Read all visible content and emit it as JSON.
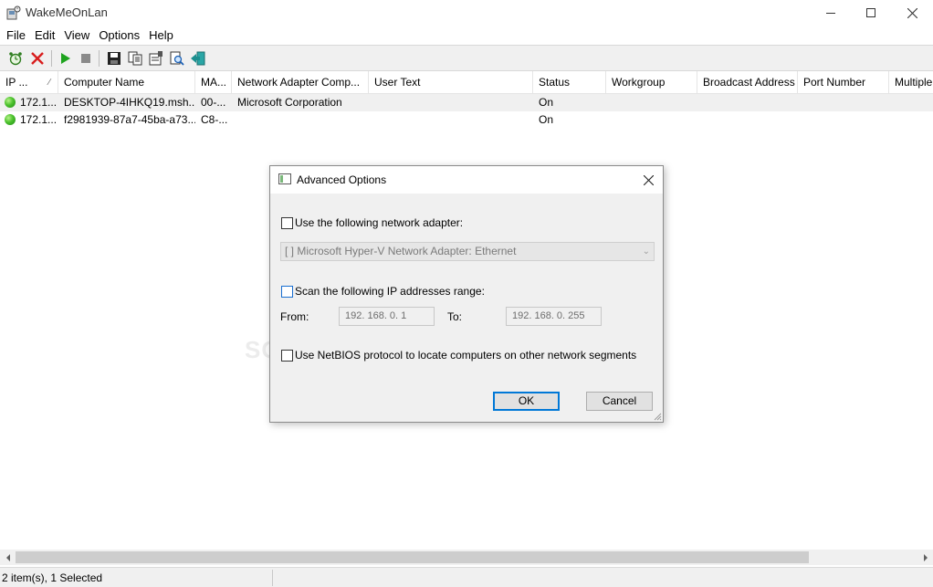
{
  "window": {
    "title": "WakeMeOnLan"
  },
  "menu": [
    "File",
    "Edit",
    "View",
    "Options",
    "Help"
  ],
  "toolbar_icons": [
    "alarm-clock-icon",
    "delete-x-icon",
    "play-icon",
    "stop-icon",
    "save-icon",
    "copy-icon",
    "properties-icon",
    "find-icon",
    "exit-icon"
  ],
  "columns": [
    {
      "label": "IP ...",
      "sort": "ascending"
    },
    {
      "label": "Computer Name"
    },
    {
      "label": "MA..."
    },
    {
      "label": "Network Adapter Comp..."
    },
    {
      "label": "User Text"
    },
    {
      "label": "Status"
    },
    {
      "label": "Workgroup"
    },
    {
      "label": "Broadcast Address"
    },
    {
      "label": "Port Number"
    },
    {
      "label": "Multiple"
    }
  ],
  "rows": [
    {
      "ip": "172.1...",
      "computer": "DESKTOP-4IHKQ19.msh...",
      "mac": "00-...",
      "adapter": "Microsoft Corporation",
      "user_text": "",
      "status": "On",
      "selected": true
    },
    {
      "ip": "172.1...",
      "computer": "f2981939-87a7-45ba-a73...",
      "mac": "C8-...",
      "adapter": "",
      "user_text": "",
      "status": "On",
      "selected": false
    }
  ],
  "status_bar": {
    "text": "2 item(s), 1 Selected"
  },
  "dialog": {
    "title": "Advanced Options",
    "use_adapter_label": "Use the following network adapter:",
    "adapter_combo": "[                    ]  Microsoft Hyper-V Network Adapter:  Ethernet",
    "scan_range_label": "Scan the following IP addresses range:",
    "from_label": "From:",
    "from_value": "192. 168. 0. 1",
    "to_label": "To:",
    "to_value": "192. 168. 0. 255",
    "netbios_label": "Use NetBIOS protocol to locate computers on other network segments",
    "ok_label": "OK",
    "cancel_label": "Cancel"
  },
  "watermark": "SOFTPEDIA",
  "colors": {
    "status_on": "#4cc22d",
    "default_button_border": "#0078d7",
    "selected_row": "#f0f0f0"
  }
}
